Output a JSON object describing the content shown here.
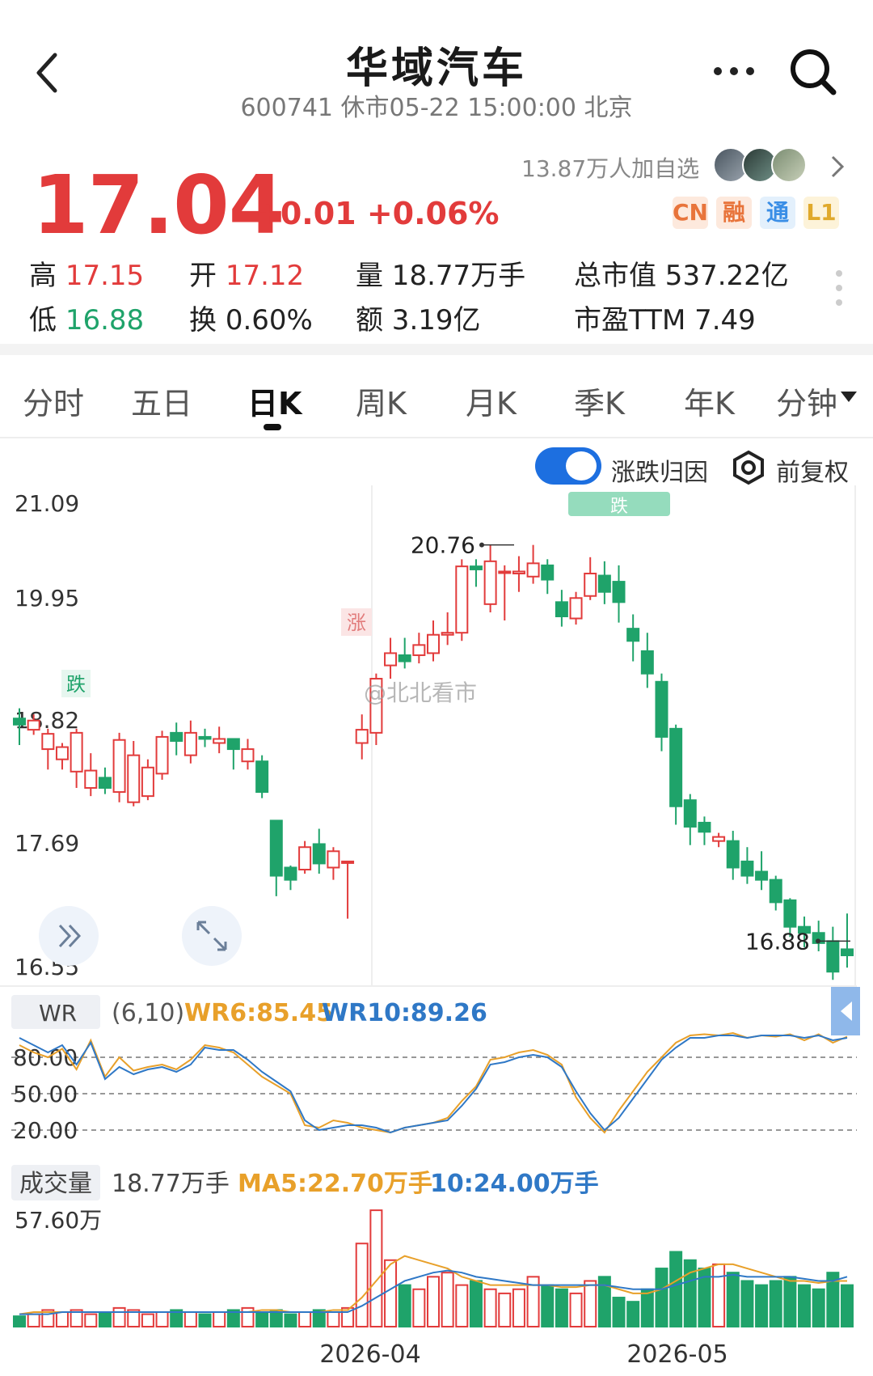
{
  "header": {
    "title": "华域汽车",
    "subtitle": "600741 休市05-22 15:00:00 北京"
  },
  "quote": {
    "price": "17.04",
    "change": "+0.01 +0.06%",
    "watchers": "13.87万人加自选",
    "tags": [
      {
        "label": "CN",
        "color": "#e8743b",
        "bg": "#fde9dd"
      },
      {
        "label": "融",
        "color": "#e8743b",
        "bg": "#fde9dd"
      },
      {
        "label": "通",
        "color": "#3a8ee6",
        "bg": "#e3f0fc"
      },
      {
        "label": "L1",
        "color": "#e0a92b",
        "bg": "#fdf3d9"
      }
    ],
    "stats": {
      "high_label": "高",
      "high_value": "17.15",
      "low_label": "低",
      "low_value": "16.88",
      "open_label": "开",
      "open_value": "17.12",
      "turnover_label": "换",
      "turnover_value": "0.60%",
      "volume": "量 18.77万手",
      "amount": "额 3.19亿",
      "mktcap": "总市值 537.22亿",
      "pe": "市盈TTM 7.49"
    }
  },
  "tabs": [
    "分时",
    "五日",
    "日K",
    "周K",
    "月K",
    "季K",
    "年K",
    "分钟"
  ],
  "chart_controls": {
    "attribution_label": "涨跌归因",
    "adjust_label": "前复权"
  },
  "kline": {
    "y_ticks": [
      "21.09",
      "19.95",
      "18.82",
      "17.69",
      "16.55"
    ],
    "high_marker": "20.76",
    "low_marker": "16.88",
    "up_badge": "涨",
    "down_badge": "跌",
    "down_badge2": "跌",
    "watermark": "@北北看市"
  },
  "wr": {
    "name": "WR",
    "params": "(6,10)",
    "wr6": "WR6:85.45",
    "wr10": "WR10:89.26",
    "levels": [
      "80.00",
      "50.00",
      "20.00"
    ]
  },
  "volume": {
    "name": "成交量",
    "value": "18.77万手",
    "ma5": "MA5:22.70万手",
    "ma10": "10:24.00万手",
    "max_label": "57.60万"
  },
  "x_dates": [
    "2026-04",
    "2026-05"
  ],
  "chart_data": {
    "type": "candlestick",
    "ylim": [
      16.55,
      21.09
    ],
    "candles": [
      [
        19.06,
        19.0,
        19.16,
        18.8
      ],
      [
        18.95,
        19.04,
        19.1,
        18.9
      ],
      [
        18.76,
        18.91,
        18.96,
        18.56
      ],
      [
        18.66,
        18.78,
        18.82,
        18.56
      ],
      [
        18.54,
        18.92,
        18.96,
        18.38
      ],
      [
        18.38,
        18.55,
        18.72,
        18.3
      ],
      [
        18.48,
        18.38,
        18.58,
        18.32
      ],
      [
        18.34,
        18.85,
        18.92,
        18.24
      ],
      [
        18.24,
        18.7,
        18.84,
        18.2
      ],
      [
        18.3,
        18.58,
        18.66,
        18.26
      ],
      [
        18.52,
        18.88,
        18.94,
        18.46
      ],
      [
        18.92,
        18.84,
        19.02,
        18.7
      ],
      [
        18.7,
        18.92,
        19.04,
        18.62
      ],
      [
        18.88,
        18.86,
        18.96,
        18.78
      ],
      [
        18.82,
        18.86,
        18.98,
        18.72
      ],
      [
        18.86,
        18.76,
        18.84,
        18.56
      ],
      [
        18.64,
        18.76,
        18.86,
        18.56
      ],
      [
        18.64,
        18.34,
        18.7,
        18.28
      ],
      [
        18.06,
        17.52,
        18.06,
        17.32
      ],
      [
        17.6,
        17.48,
        17.62,
        17.38
      ],
      [
        17.58,
        17.8,
        17.86,
        17.54
      ],
      [
        17.83,
        17.64,
        17.98,
        17.54
      ],
      [
        17.6,
        17.76,
        17.8,
        17.48
      ],
      [
        17.66,
        17.66,
        17.66,
        17.1
      ],
      [
        18.82,
        18.95,
        19.1,
        18.66
      ],
      [
        18.92,
        19.45,
        19.5,
        18.8
      ],
      [
        19.58,
        19.7,
        19.85,
        19.45
      ],
      [
        19.68,
        19.62,
        19.85,
        19.55
      ],
      [
        19.68,
        19.78,
        19.9,
        19.6
      ],
      [
        19.7,
        19.88,
        20.02,
        19.62
      ],
      [
        19.88,
        19.9,
        20.1,
        19.78
      ],
      [
        19.9,
        20.55,
        20.62,
        19.82
      ],
      [
        20.55,
        20.52,
        20.62,
        20.35
      ],
      [
        20.18,
        20.6,
        20.76,
        20.1
      ],
      [
        20.5,
        20.5,
        20.56,
        20.02
      ],
      [
        20.48,
        20.5,
        20.65,
        20.3
      ],
      [
        20.45,
        20.58,
        20.76,
        20.38
      ],
      [
        20.56,
        20.42,
        20.62,
        20.28
      ],
      [
        20.2,
        20.06,
        20.32,
        19.96
      ],
      [
        20.04,
        20.24,
        20.3,
        19.98
      ],
      [
        20.26,
        20.48,
        20.64,
        20.22
      ],
      [
        20.46,
        20.3,
        20.6,
        20.18
      ],
      [
        20.4,
        20.2,
        20.56,
        20.0
      ],
      [
        19.94,
        19.82,
        20.08,
        19.62
      ],
      [
        19.72,
        19.5,
        19.9,
        19.36
      ],
      [
        19.42,
        18.88,
        19.5,
        18.74
      ],
      [
        18.96,
        18.2,
        19.0,
        18.02
      ],
      [
        18.26,
        18.0,
        18.32,
        17.82
      ],
      [
        18.04,
        17.95,
        18.1,
        17.82
      ],
      [
        17.86,
        17.9,
        17.94,
        17.8
      ],
      [
        17.86,
        17.6,
        17.96,
        17.48
      ],
      [
        17.66,
        17.52,
        17.8,
        17.44
      ],
      [
        17.56,
        17.48,
        17.76,
        17.38
      ],
      [
        17.48,
        17.26,
        17.52,
        17.18
      ],
      [
        17.28,
        17.02,
        17.3,
        16.92
      ],
      [
        17.02,
        16.96,
        17.12,
        16.82
      ],
      [
        16.96,
        16.86,
        17.08,
        16.78
      ],
      [
        16.88,
        16.58,
        17.02,
        16.5
      ],
      [
        16.8,
        16.74,
        17.15,
        16.62
      ]
    ],
    "wr6": [
      12,
      18,
      22,
      15,
      32,
      8,
      38,
      22,
      33,
      30,
      28,
      32,
      24,
      12,
      14,
      18,
      28,
      38,
      45,
      52,
      78,
      80,
      74,
      76,
      80,
      82,
      84,
      80,
      78,
      76,
      72,
      58,
      46,
      24,
      22,
      18,
      16,
      20,
      28,
      55,
      72,
      84,
      66,
      50,
      34,
      22,
      10,
      4,
      3,
      4,
      2,
      6,
      4,
      5,
      3,
      8,
      3,
      10,
      5
    ],
    "wr10": [
      6,
      12,
      18,
      12,
      28,
      10,
      40,
      30,
      36,
      32,
      30,
      34,
      28,
      14,
      16,
      16,
      24,
      34,
      42,
      50,
      74,
      82,
      80,
      78,
      78,
      80,
      84,
      80,
      78,
      76,
      74,
      62,
      48,
      28,
      26,
      22,
      20,
      22,
      30,
      50,
      68,
      82,
      72,
      56,
      40,
      24,
      14,
      6,
      6,
      4,
      4,
      6,
      4,
      4,
      4,
      6,
      4,
      8,
      6
    ],
    "vol": [
      5,
      6,
      8,
      7,
      8,
      6,
      7,
      9,
      8,
      6,
      7,
      8,
      7,
      6,
      7,
      8,
      9,
      7,
      8,
      6,
      7,
      8,
      7,
      9,
      40,
      56,
      32,
      20,
      18,
      24,
      26,
      20,
      22,
      18,
      16,
      18,
      24,
      20,
      18,
      16,
      22,
      24,
      14,
      12,
      18,
      28,
      36,
      32,
      28,
      30,
      26,
      22,
      20,
      22,
      24,
      20,
      18,
      26,
      20
    ],
    "ma5": [
      6,
      7,
      7,
      7,
      7,
      7,
      7,
      7,
      7,
      7,
      7,
      7,
      7,
      7,
      7,
      7,
      7,
      8,
      8,
      7,
      7,
      7,
      8,
      8,
      14,
      22,
      30,
      34,
      32,
      30,
      28,
      24,
      22,
      20,
      20,
      20,
      20,
      20,
      19,
      19,
      20,
      20,
      18,
      16,
      16,
      18,
      22,
      26,
      28,
      30,
      30,
      28,
      26,
      24,
      22,
      22,
      21,
      22,
      22
    ],
    "ma10": [
      6,
      6,
      6,
      7,
      7,
      7,
      7,
      7,
      7,
      7,
      7,
      7,
      7,
      7,
      7,
      7,
      7,
      7,
      7,
      7,
      7,
      7,
      7,
      7,
      10,
      14,
      18,
      22,
      24,
      26,
      27,
      26,
      24,
      23,
      22,
      21,
      20,
      20,
      20,
      20,
      20,
      20,
      19,
      18,
      18,
      18,
      20,
      22,
      24,
      24,
      25,
      24,
      24,
      24,
      24,
      23,
      22,
      22,
      24
    ]
  }
}
